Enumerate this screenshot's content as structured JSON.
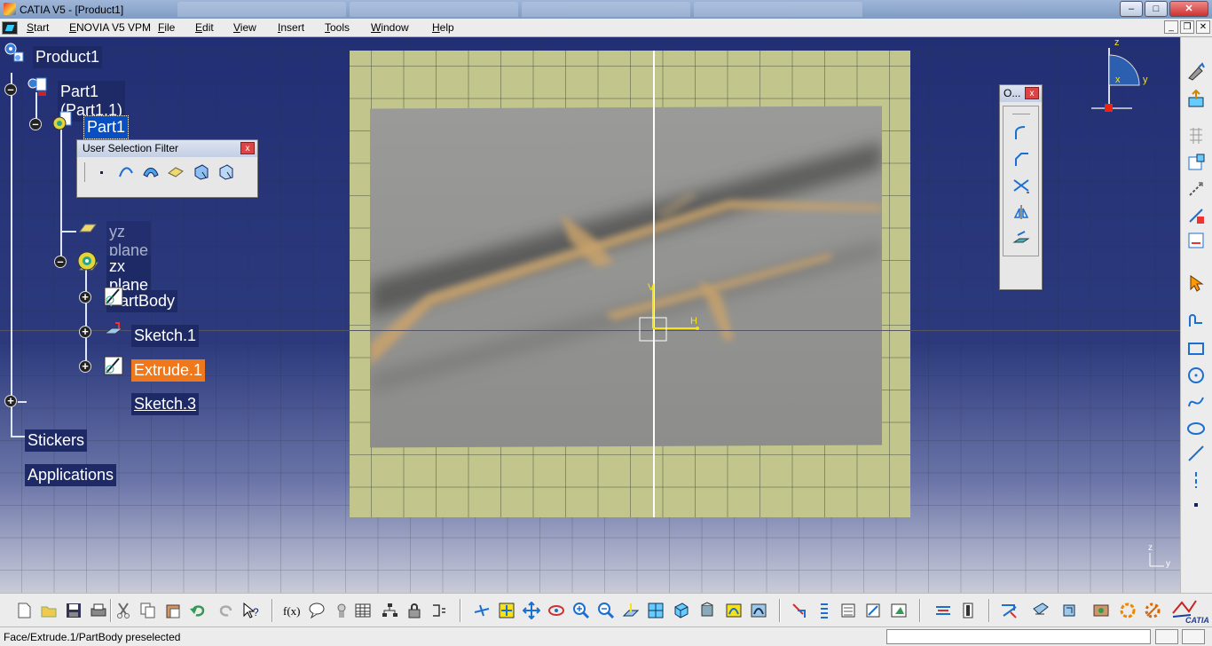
{
  "window": {
    "title": "CATIA V5 - [Product1]"
  },
  "menu": {
    "items": [
      "Start",
      "ENOVIA V5 VPM",
      "File",
      "Edit",
      "View",
      "Insert",
      "Tools",
      "Window",
      "Help"
    ]
  },
  "tree": {
    "product": "Product1",
    "part_instance": "Part1 (Part1.1)",
    "part": "Part1",
    "yz_plane": "yz plane",
    "zx_plane": "zx plane",
    "partbody": "PartBody",
    "sketch1": "Sketch.1",
    "extrude1": "Extrude.1",
    "sketch3": "Sketch.3",
    "stickers": "Stickers",
    "applications": "Applications"
  },
  "selection_filter": {
    "title": "User Selection Filter",
    "close": "x"
  },
  "ops_toolbar": {
    "title": "O...",
    "close": "x"
  },
  "compass": {
    "z": "z",
    "x": "x",
    "y": "y"
  },
  "axis_labels": {
    "h": "H",
    "v": "V"
  },
  "mini_axis": {
    "z": "z",
    "y": "y"
  },
  "status": {
    "message": "Face/Extrude.1/PartBody preselected",
    "power_input": ""
  },
  "catia_logo": "CATIA",
  "colors": {
    "viewport_top": "#232f74",
    "sketch_plane": "#c3c68c",
    "highlight": "#f0781c",
    "selected": "#0a4fc2"
  }
}
